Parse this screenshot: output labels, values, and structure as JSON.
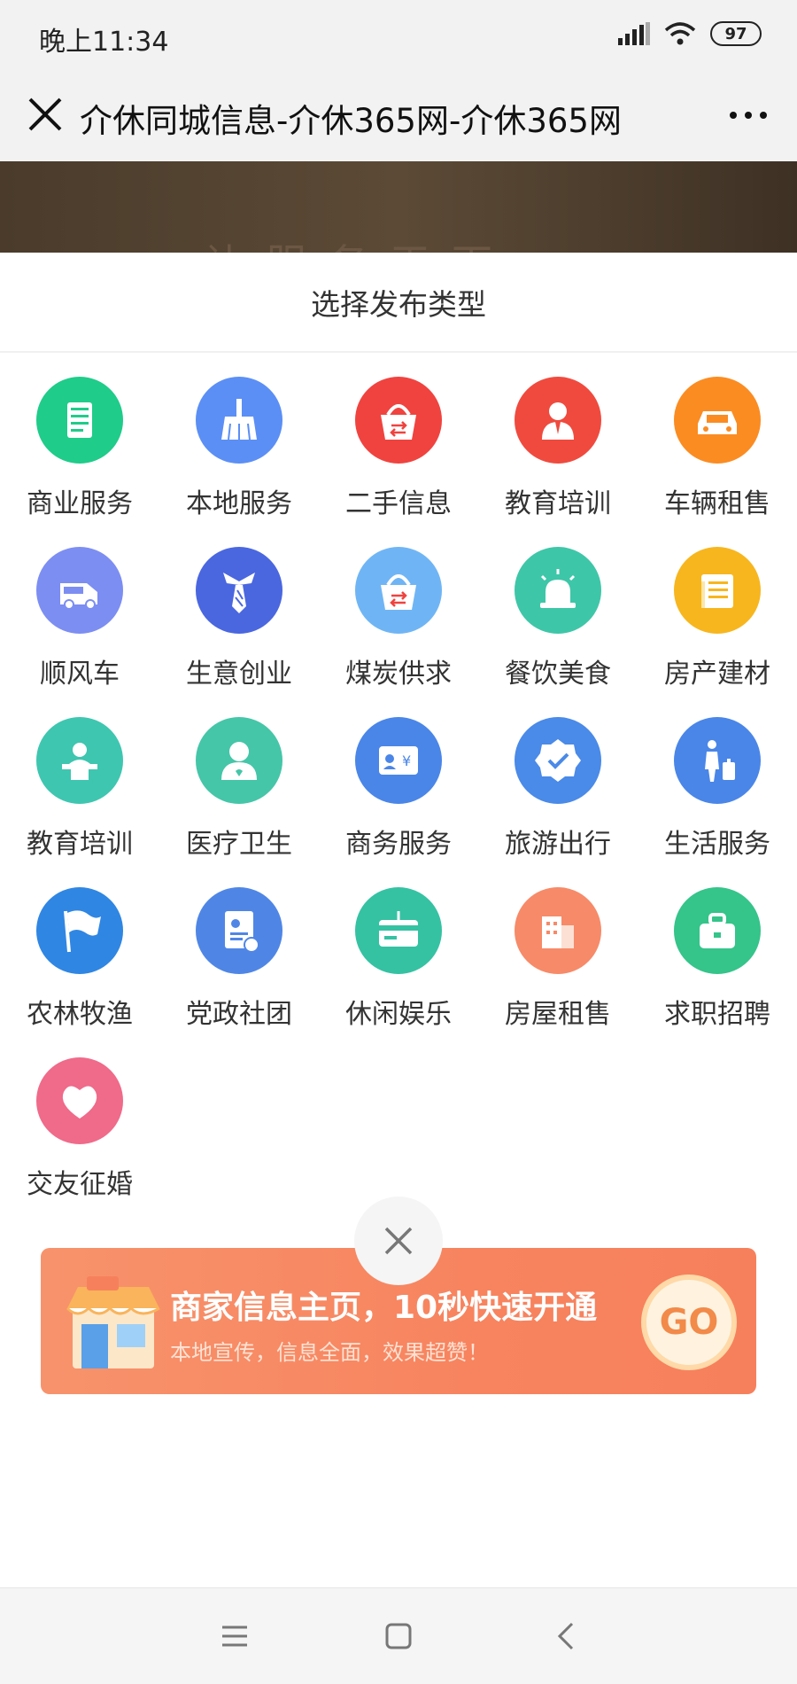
{
  "status_bar": {
    "time": "晚上11:34",
    "battery": "97",
    "icons": [
      "signal-icon",
      "wifi-icon",
      "battery-icon"
    ]
  },
  "title_bar": {
    "title": "介休同城信息-介休365网-介休365网",
    "close_icon": "close-icon",
    "more_icon": "more-icon"
  },
  "background_page": {
    "partial_text": "让服务天下"
  },
  "sheet": {
    "title": "选择发布类型",
    "categories": [
      {
        "label": "商业服务",
        "icon": "document-icon",
        "color": "#1fcc8a"
      },
      {
        "label": "本地服务",
        "icon": "broom-icon",
        "color": "#5b8ff5"
      },
      {
        "label": "二手信息",
        "icon": "basket-icon",
        "color": "#f0433f"
      },
      {
        "label": "教育培训",
        "icon": "teacher-icon",
        "color": "#f04a3e"
      },
      {
        "label": "车辆租售",
        "icon": "car-icon",
        "color": "#fb8c22"
      },
      {
        "label": "顺风车",
        "icon": "van-icon",
        "color": "#7c8ef2"
      },
      {
        "label": "生意创业",
        "icon": "tie-icon",
        "color": "#4a67e0"
      },
      {
        "label": "煤炭供求",
        "icon": "basket-icon",
        "color": "#6fb5f5"
      },
      {
        "label": "餐饮美食",
        "icon": "siren-icon",
        "color": "#3ec6a8"
      },
      {
        "label": "房产建材",
        "icon": "newspaper-icon",
        "color": "#f7b61e"
      },
      {
        "label": "教育培训",
        "icon": "lectern-icon",
        "color": "#3ec6b0"
      },
      {
        "label": "医疗卫生",
        "icon": "doctor-icon",
        "color": "#45c6a8"
      },
      {
        "label": "商务服务",
        "icon": "business-card-icon",
        "color": "#4a86e8"
      },
      {
        "label": "旅游出行",
        "icon": "badge-check-icon",
        "color": "#4a8ae8"
      },
      {
        "label": "生活服务",
        "icon": "traveler-icon",
        "color": "#4a86e8"
      },
      {
        "label": "农林牧渔",
        "icon": "flag-icon",
        "color": "#2f86e3"
      },
      {
        "label": "党政社团",
        "icon": "id-card-icon",
        "color": "#4f86e6"
      },
      {
        "label": "休闲娱乐",
        "icon": "card-icon",
        "color": "#35c2a3"
      },
      {
        "label": "房屋租售",
        "icon": "building-icon",
        "color": "#f78a68"
      },
      {
        "label": "求职招聘",
        "icon": "briefcase-icon",
        "color": "#35c48a"
      },
      {
        "label": "交友征婚",
        "icon": "heart-icon",
        "color": "#f06a8a"
      }
    ]
  },
  "banner": {
    "title": "商家信息主页，10秒快速开通",
    "subtitle": "本地宣传，信息全面，效果超赞！",
    "go_label": "GO"
  },
  "dismiss": {
    "icon": "close-icon"
  },
  "nav_bar": {
    "icons": [
      "menu-icon",
      "home-square-icon",
      "back-chevron-icon"
    ]
  }
}
